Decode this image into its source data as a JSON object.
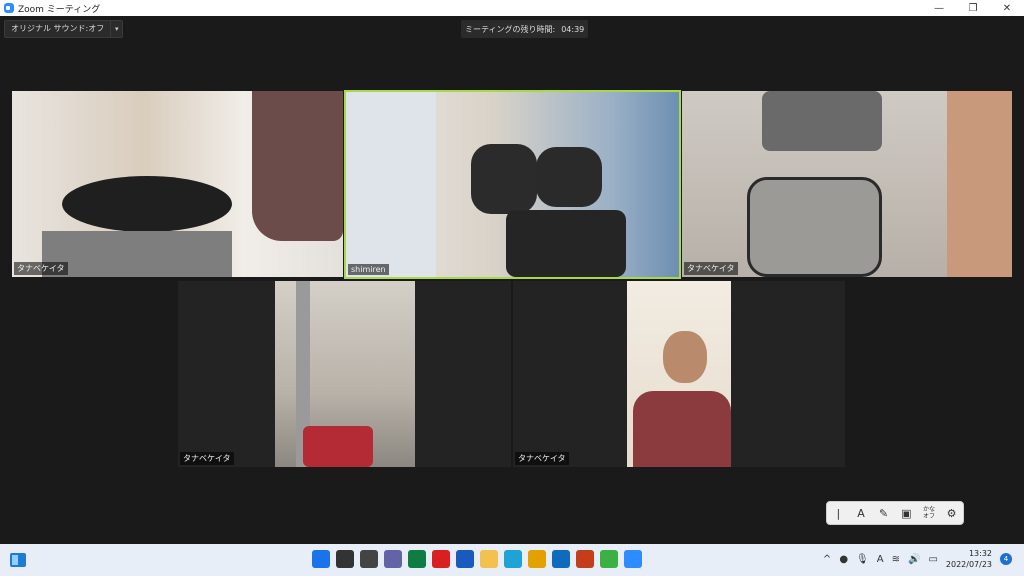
{
  "window": {
    "title": "Zoom ミーティング",
    "minimize_glyph": "—",
    "maximize_glyph": "❐",
    "close_glyph": "✕"
  },
  "toolbar": {
    "original_sound": "オリジナル サウンド:オフ",
    "dropdown_glyph": "▾",
    "remaining_label": "ミーティングの残り時間:",
    "remaining_time": "04:39"
  },
  "participants": [
    {
      "name": "タナベケイタ",
      "active": false
    },
    {
      "name": "shimiren",
      "active": true
    },
    {
      "name": "タナベケイタ",
      "active": false
    },
    {
      "name": "タナベケイタ",
      "active": false
    },
    {
      "name": "タナベケイタ",
      "active": false
    }
  ],
  "ime_toolbar": {
    "cursor_glyph": "|",
    "mode_glyph": "A",
    "kana_line1": "かな",
    "kana_line2": "オフ",
    "gear_glyph": "⚙"
  },
  "taskbar": {
    "apps": [
      {
        "icon": "windows-start-icon",
        "color": "#1a73e8"
      },
      {
        "icon": "search-icon",
        "color": "#333333"
      },
      {
        "icon": "task-view-icon",
        "color": "#444444"
      },
      {
        "icon": "chat-icon",
        "color": "#6264a7"
      },
      {
        "icon": "excel-icon",
        "color": "#107c41"
      },
      {
        "icon": "acrobat-icon",
        "color": "#d7201f"
      },
      {
        "icon": "word-icon",
        "color": "#185abd"
      },
      {
        "icon": "file-explorer-icon",
        "color": "#f2c14e"
      },
      {
        "icon": "edge-icon",
        "color": "#1fa2d6"
      },
      {
        "icon": "chrome-icon",
        "color": "#e2a100"
      },
      {
        "icon": "outlook-icon",
        "color": "#0f6cbd"
      },
      {
        "icon": "powerpoint-icon",
        "color": "#c43e1c"
      },
      {
        "icon": "wps-writer-icon",
        "color": "#3cb043"
      },
      {
        "icon": "zoom-icon",
        "color": "#2d8cff"
      }
    ],
    "tray": {
      "chevron_glyph": "^",
      "ime_glyph": "A",
      "time": "13:32",
      "date": "2022/07/23",
      "notifications": "4"
    }
  }
}
